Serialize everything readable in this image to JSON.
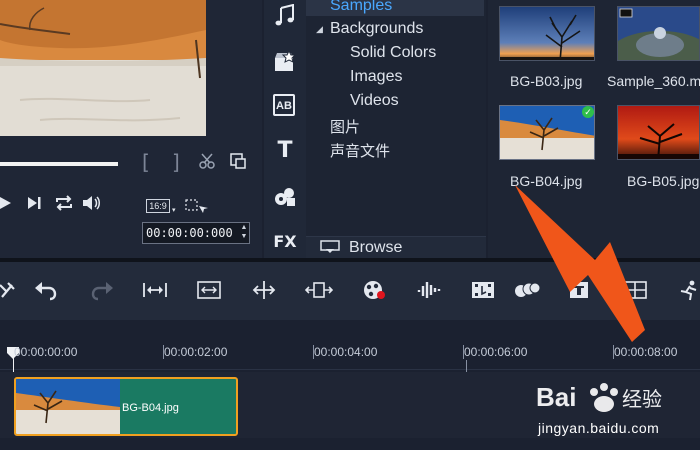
{
  "preview": {
    "timecode": "00:00:00:000",
    "aspect": "16:9"
  },
  "library": {
    "tree": {
      "samples": "Samples",
      "backgrounds": "Backgrounds",
      "solid_colors": "Solid Colors",
      "images": "Images",
      "videos": "Videos",
      "chinese_images": "图片",
      "chinese_audio": "声音文件"
    },
    "browse_label": "Browse",
    "rail_labels": {
      "ab": "AB",
      "fx": "FX",
      "t": "T"
    },
    "thumbnails": [
      {
        "label": "BG-B03.jpg"
      },
      {
        "label": "Sample_360.m"
      },
      {
        "label": "BG-B04.jpg"
      },
      {
        "label": "BG-B05.jpg"
      }
    ]
  },
  "timeline": {
    "ruler": [
      "00:00:00:00",
      "00:00:02:00",
      "00:00:04:00",
      "00:00:06:00",
      "00:00:08:00"
    ],
    "clip_label": "BG-B04.jpg"
  },
  "watermark": {
    "url": "jingyan.baidu.com",
    "logo_text": "Bai 经验"
  },
  "colors": {
    "annotation_arrow": "#f0561a",
    "clip_fill": "#1a7a62",
    "clip_border": "#f0a020",
    "selected_check": "#2fbf4a"
  }
}
